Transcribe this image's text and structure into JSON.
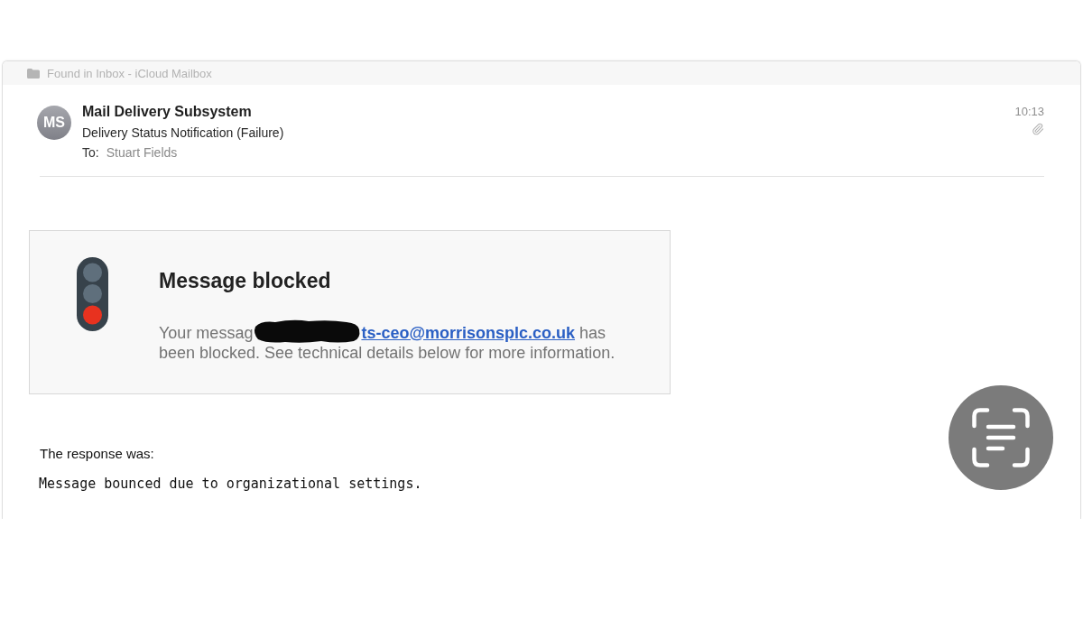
{
  "window": {
    "title": "Found in Inbox - iCloud Mailbox"
  },
  "message": {
    "avatar_initials": "MS",
    "sender": "Mail Delivery Subsystem",
    "subject": "Delivery Status Notification (Failure)",
    "to_label": "To:",
    "recipient": "Stuart Fields",
    "time": "10:13",
    "has_attachment": true
  },
  "notice": {
    "title": "Message blocked",
    "text_before": "Your messag",
    "redacted": true,
    "link": "ts-ceo@morrisonsplc.co.uk",
    "text_after": "has been blocked. See technical details below for more information."
  },
  "response": {
    "label": "The response was:",
    "detail": "Message bounced due to organizational settings."
  }
}
